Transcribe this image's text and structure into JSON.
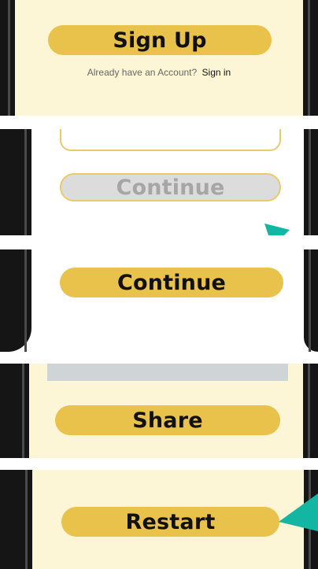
{
  "panels": {
    "signup": {
      "button_label": "Sign Up",
      "prompt_text": "Already have an Account?",
      "signin_link": "Sign in"
    },
    "continue_disabled": {
      "button_label": "Continue",
      "state": "disabled"
    },
    "continue_enabled": {
      "button_label": "Continue"
    },
    "share": {
      "button_label": "Share"
    },
    "restart": {
      "button_label": "Restart"
    }
  },
  "colors": {
    "accent_button": "#e9c24c",
    "cream_background": "#fdf6d6",
    "disabled_button": "#dcdcdc",
    "disabled_text": "#a6a6a6",
    "arrow_teal": "#13b5a3",
    "frame": "#151515",
    "progress_gray": "#cfd4d6"
  },
  "icons": {
    "pointer_arrow": "arrow-pointer-icon"
  }
}
